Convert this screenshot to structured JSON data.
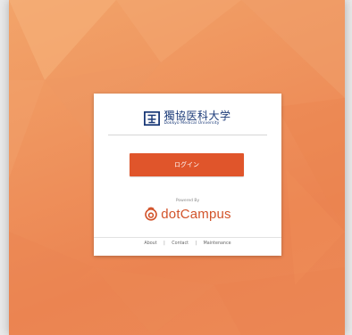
{
  "university": {
    "name_jp": "獨協医科大学",
    "name_en": "Dokkyo Medical University"
  },
  "login": {
    "button_label": "ログイン"
  },
  "powered": {
    "label": "Powered By",
    "brand_prefix": "dot",
    "brand_suffix": "Campus"
  },
  "footer": {
    "links": [
      {
        "label": "About"
      },
      {
        "label": "Contact"
      },
      {
        "label": "Maintenance"
      }
    ],
    "separator": "|"
  },
  "colors": {
    "background": "#ee8f5a",
    "login_button": "#e0552b",
    "brand": "#d2532a",
    "university": "#1b3a78"
  },
  "icons": {
    "university_logo": "dokkyo-logo-icon",
    "brand_logo": "dotcampus-logo-icon"
  }
}
